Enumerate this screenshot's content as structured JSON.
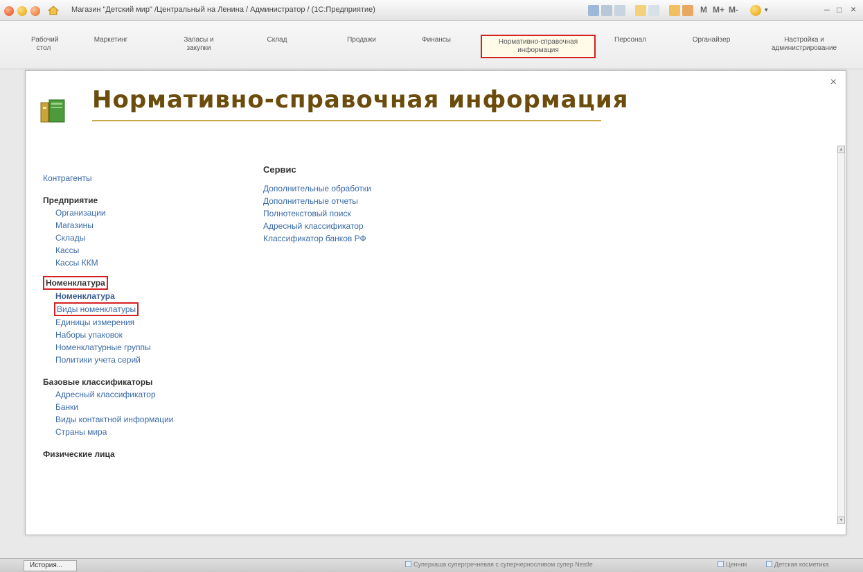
{
  "window": {
    "title": "Магазин \"Детский мир\" /Центральный на Ленина / Администратор / (1С:Предприятие)",
    "toolbar_letters": [
      "M",
      "M+",
      "M-"
    ]
  },
  "sections": [
    {
      "label": "Рабочий\nстол"
    },
    {
      "label": "Маркетинг"
    },
    {
      "label": "Запасы и\nзакупки"
    },
    {
      "label": "Склад"
    },
    {
      "label": "Продажи"
    },
    {
      "label": "Финансы"
    },
    {
      "label": "Нормативно-справочная\nинформация",
      "active": true
    },
    {
      "label": "Персонал"
    },
    {
      "label": "Органайзер"
    },
    {
      "label": "Настройка и\nадминистрирование"
    }
  ],
  "page": {
    "title": "Нормативно-справочная информация",
    "close_label": "×"
  },
  "left": {
    "counterparties": "Контрагенты",
    "enterprise": {
      "title": "Предприятие",
      "items": [
        "Организации",
        "Магазины",
        "Склады",
        "Кассы",
        "Кассы ККМ"
      ]
    },
    "nomenclature": {
      "title": "Номенклатура",
      "items": [
        "Номенклатура",
        "Виды номенклатуры",
        "Единицы измерения",
        "Наборы упаковок",
        "Номенклатурные группы",
        "Политики учета серий"
      ]
    },
    "classifiers": {
      "title": "Базовые классификаторы",
      "items": [
        "Адресный классификатор",
        "Банки",
        "Виды контактной информации",
        "Страны мира"
      ]
    },
    "persons": {
      "title": "Физические лица"
    }
  },
  "right": {
    "title": "Сервис",
    "items": [
      "Дополнительные обработки",
      "Дополнительные отчеты",
      "Полнотекстовый поиск",
      "Адресный классификатор",
      "Классификатор банков РФ"
    ]
  },
  "statusbar": {
    "history": "История...",
    "items": [
      "Суперкаша супергречневая с суперчерносливом супер Nestle",
      "Ценник",
      "Детская косметика"
    ]
  },
  "colors": {
    "accent": "#d42020",
    "title": "#6b4c0c",
    "link": "#3a6aa6"
  }
}
